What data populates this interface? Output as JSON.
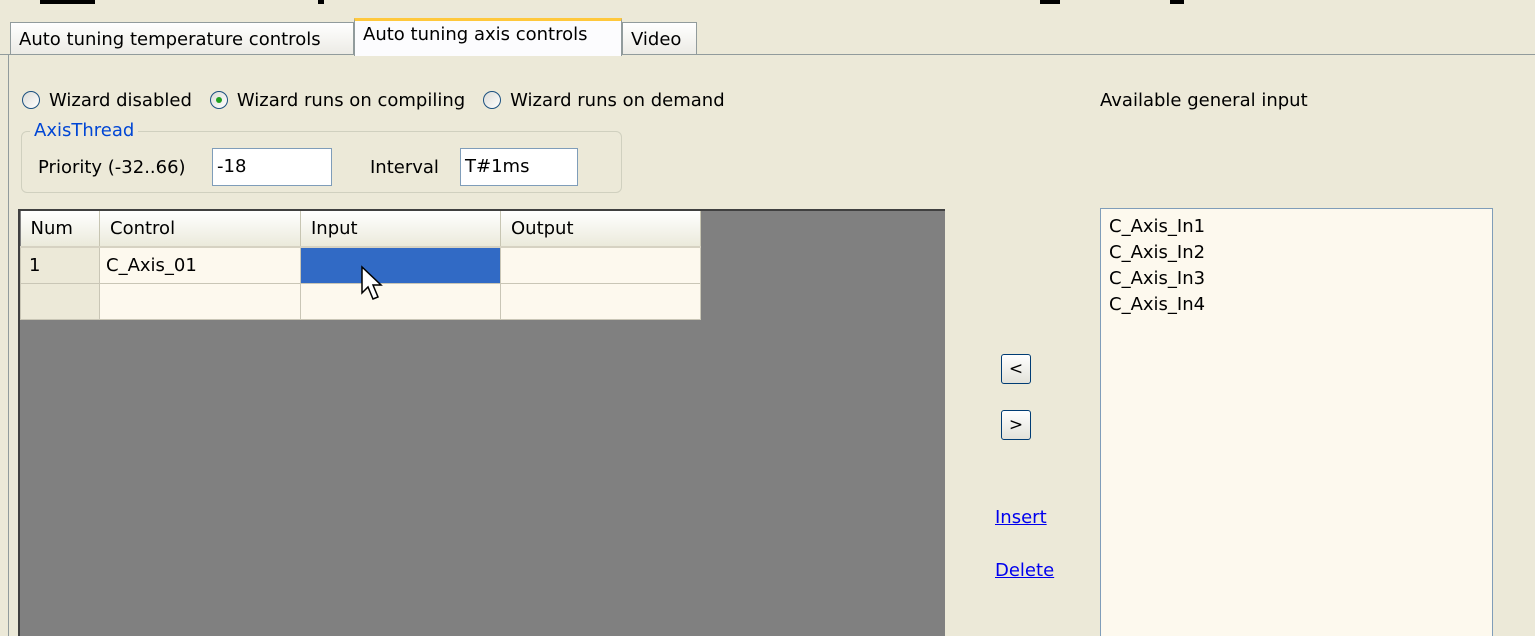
{
  "tabs": [
    {
      "label": "Auto tuning temperature controls",
      "active": false
    },
    {
      "label": "Auto tuning axis controls",
      "active": true
    },
    {
      "label": "Video",
      "active": false
    }
  ],
  "wizard": {
    "options": [
      {
        "label": "Wizard disabled",
        "checked": false
      },
      {
        "label": "Wizard runs on compiling",
        "checked": true
      },
      {
        "label": "Wizard runs on demand",
        "checked": false
      }
    ]
  },
  "axis_thread": {
    "title": "AxisThread",
    "priority_label": "Priority (-32..66)",
    "priority_value": "-18",
    "interval_label": "Interval",
    "interval_value": "T#1ms"
  },
  "grid": {
    "headers": [
      "Num",
      "Control",
      "Input",
      "Output"
    ],
    "rows": [
      [
        "1",
        "C_Axis_01",
        "",
        ""
      ],
      [
        "",
        "",
        "",
        ""
      ]
    ]
  },
  "buttons": {
    "move_left": "<",
    "move_right": ">",
    "insert": "Insert",
    "delete": "Delete"
  },
  "available": {
    "label": "Available general input",
    "items": [
      "C_Axis_In1",
      "C_Axis_In2",
      "C_Axis_In3",
      "C_Axis_In4"
    ]
  },
  "colors": {
    "background": "#ece9d8",
    "selection": "#316ac5",
    "group_title": "#0046d5",
    "link": "#0000ee",
    "tab_highlight": "#ffc83c"
  }
}
